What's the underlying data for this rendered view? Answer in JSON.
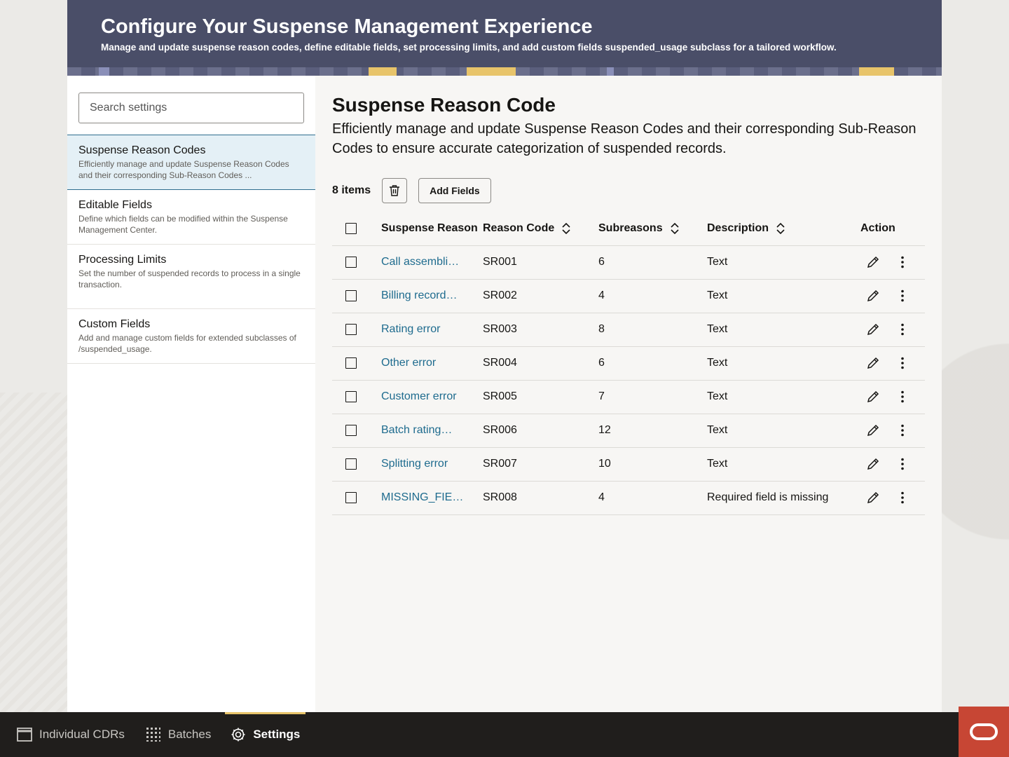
{
  "banner": {
    "title": "Configure Your Suspense Management Experience",
    "subtitle": "Manage and update suspense reason codes, define editable fields, set processing limits, and add custom fields suspended_usage subclass for a tailored workflow."
  },
  "sidebar": {
    "search_placeholder": "Search settings",
    "items": [
      {
        "title": "Suspense Reason Codes",
        "desc": "Efficiently manage and update Suspense Reason Codes and their corresponding Sub-Reason Codes ..."
      },
      {
        "title": "Editable Fields",
        "desc": "Define which fields can be modified within the Suspense Management Center."
      },
      {
        "title": "Processing Limits",
        "desc": "Set the number of suspended records to process in a single transaction."
      },
      {
        "title": "Custom Fields",
        "desc": "Add and manage custom fields for extended subclasses of /suspended_usage."
      }
    ]
  },
  "main": {
    "title": "Suspense Reason Code",
    "description": "Efficiently manage and update Suspense Reason Codes and their corresponding Sub-Reason Codes to ensure accurate categorization of suspended records.",
    "items_count": "8 items",
    "add_fields_label": "Add Fields",
    "columns": {
      "reason": "Suspense Reason",
      "code": "Reason Code",
      "subreasons": "Subreasons",
      "description": "Description",
      "action": "Action"
    },
    "rows": [
      {
        "reason": "Call assembli…",
        "code": "SR001",
        "subreasons": "6",
        "description": "Text"
      },
      {
        "reason": "Billing record…",
        "code": "SR002",
        "subreasons": "4",
        "description": "Text"
      },
      {
        "reason": "Rating error",
        "code": "SR003",
        "subreasons": "8",
        "description": "Text"
      },
      {
        "reason": "Other error",
        "code": "SR004",
        "subreasons": "6",
        "description": "Text"
      },
      {
        "reason": "Customer error",
        "code": "SR005",
        "subreasons": "7",
        "description": "Text"
      },
      {
        "reason": "Batch rating…",
        "code": "SR006",
        "subreasons": "12",
        "description": "Text"
      },
      {
        "reason": "Splitting error",
        "code": "SR007",
        "subreasons": "10",
        "description": "Text"
      },
      {
        "reason": "MISSING_FIE…",
        "code": "SR008",
        "subreasons": "4",
        "description": "Required field is missing"
      }
    ]
  },
  "footer": {
    "tabs": [
      {
        "label": "Individual CDRs",
        "icon": "window-icon"
      },
      {
        "label": "Batches",
        "icon": "grid-icon"
      },
      {
        "label": "Settings",
        "icon": "gear-icon"
      }
    ]
  },
  "colors": {
    "banner": "#4a4e68",
    "link": "#1e6b8e",
    "accent": "#e8c46a",
    "footer": "#201e1c",
    "brand": "#c74634"
  }
}
